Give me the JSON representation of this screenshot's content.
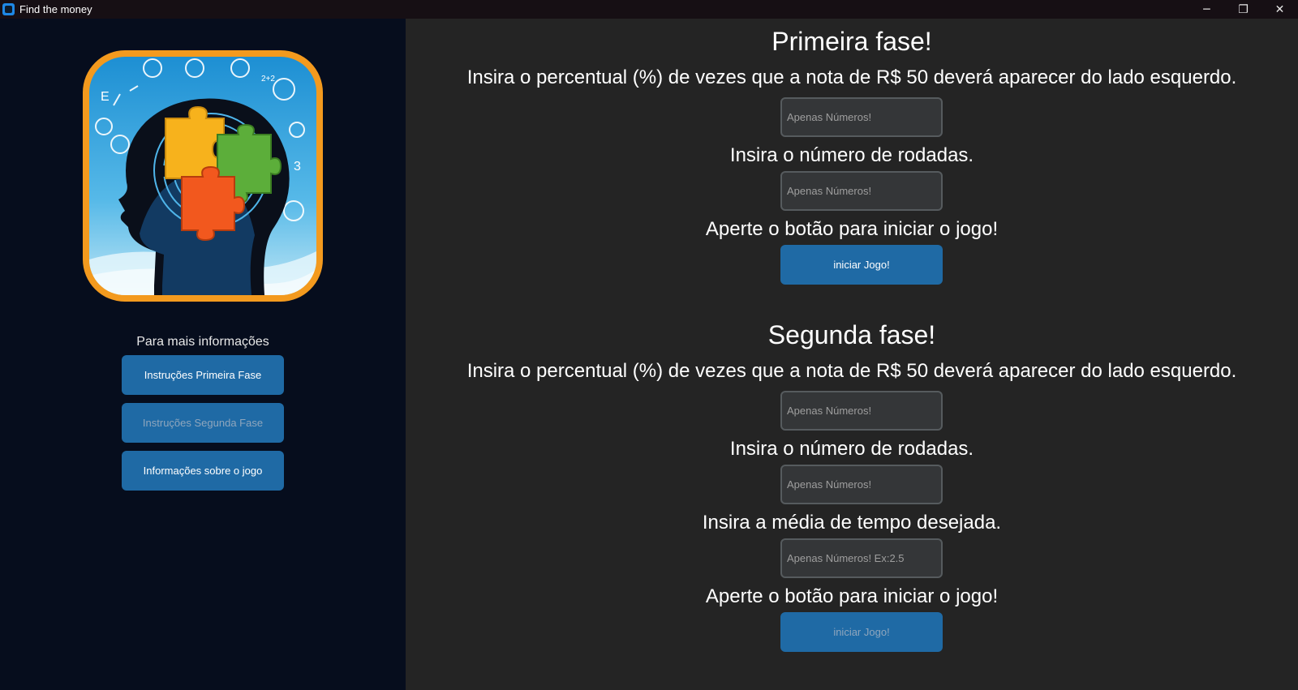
{
  "window": {
    "title": "Find the money",
    "controls": {
      "minimize": "─",
      "maximize": "❐",
      "close": "✕"
    }
  },
  "sidebar": {
    "info_label": "Para mais informações",
    "buttons": [
      {
        "label": "Instruções Primeira Fase",
        "enabled": true
      },
      {
        "label": "Instruções Segunda Fase",
        "enabled": false
      },
      {
        "label": "Informações sobre o jogo",
        "enabled": true
      }
    ]
  },
  "phase1": {
    "title": "Primeira fase!",
    "percent_prompt": "Insira o percentual (%) de vezes que a nota de R$ 50 deverá aparecer do lado esquerdo.",
    "percent_placeholder": "Apenas Números!",
    "rounds_prompt": "Insira o número de rodadas.",
    "rounds_placeholder": "Apenas Números!",
    "start_prompt": "Aperte o botão para iniciar o jogo!",
    "start_label": "iniciar Jogo!"
  },
  "phase2": {
    "title": "Segunda fase!",
    "percent_prompt": "Insira o percentual (%) de vezes que a nota de R$ 50 deverá aparecer do lado esquerdo.",
    "percent_placeholder": "Apenas Números!",
    "rounds_prompt": "Insira o número de rodadas.",
    "rounds_placeholder": "Apenas Números!",
    "time_prompt": "Insira a média de tempo desejada.",
    "time_placeholder": "Apenas Números! Ex:2.5",
    "start_prompt": "Aperte o botão para iniciar o jogo!",
    "start_label": "iniciar Jogo!"
  },
  "colors": {
    "sidebar_bg": "#060d1d",
    "main_bg": "#242424",
    "button": "#1f6aa5",
    "entry_bg": "#343638",
    "entry_border": "#565b5e",
    "logo_frame": "#f39a1e",
    "logo_sky": "#3aa7de"
  },
  "logo": {
    "icon": "brain-puzzle-logo",
    "glyphs": [
      "2+2",
      "3",
      "E"
    ]
  }
}
